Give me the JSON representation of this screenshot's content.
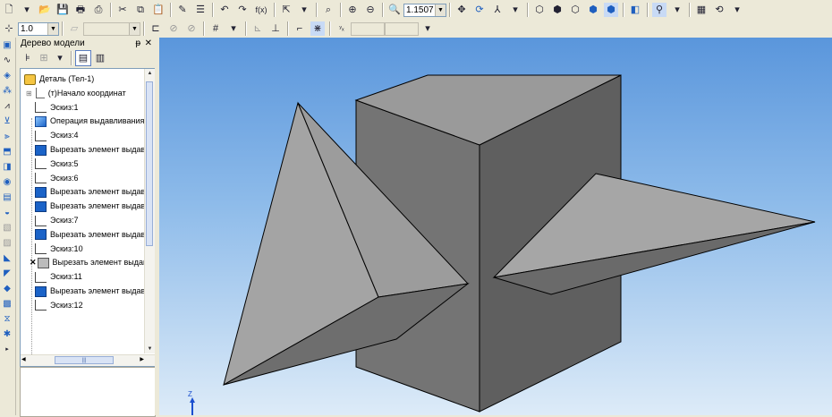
{
  "toolbar": {
    "scale_value": "1.1507",
    "line_weight_value": "1.0",
    "fx_label": "f(x)"
  },
  "tree": {
    "title": "Дерево модели",
    "pin_glyph": "ᵽ",
    "close_glyph": "✕",
    "items": [
      {
        "label": "Деталь (Тел-1)",
        "icon": "part-icon"
      },
      {
        "label": "(т)Начало координат",
        "icon": "origin-icon"
      },
      {
        "label": "Эскиз:1",
        "icon": "sketch-icon"
      },
      {
        "label": "Операция выдавливания",
        "icon": "extrude-icon"
      },
      {
        "label": "Эскиз:4",
        "icon": "sketch-icon"
      },
      {
        "label": "Вырезать элемент выдавливания",
        "icon": "cut-extrude-icon"
      },
      {
        "label": "Эскиз:5",
        "icon": "sketch-icon"
      },
      {
        "label": "Эскиз:6",
        "icon": "sketch-icon"
      },
      {
        "label": "Вырезать элемент выдавливания",
        "icon": "cut-extrude-icon"
      },
      {
        "label": "Вырезать элемент выдавливания",
        "icon": "cut-extrude-icon"
      },
      {
        "label": "Эскиз:7",
        "icon": "sketch-icon"
      },
      {
        "label": "Вырезать элемент выдавливания",
        "icon": "cut-extrude-icon"
      },
      {
        "label": "Эскиз:10",
        "icon": "sketch-icon"
      },
      {
        "label": "Вырезать элемент выдавливания",
        "icon": "cut-extrude-icon",
        "error": true
      },
      {
        "label": "Эскиз:11",
        "icon": "sketch-icon"
      },
      {
        "label": "Вырезать элемент выдавливания",
        "icon": "cut-extrude-icon"
      },
      {
        "label": "Эскиз:12",
        "icon": "sketch-icon"
      }
    ]
  },
  "viewport": {
    "axis_label": "Z",
    "colors": {
      "face_top": "#999999",
      "face_front": "#727272",
      "face_side": "#5e5e5e",
      "wing_light": "#a3a3a3",
      "wing_dark": "#6f6f6f"
    }
  }
}
